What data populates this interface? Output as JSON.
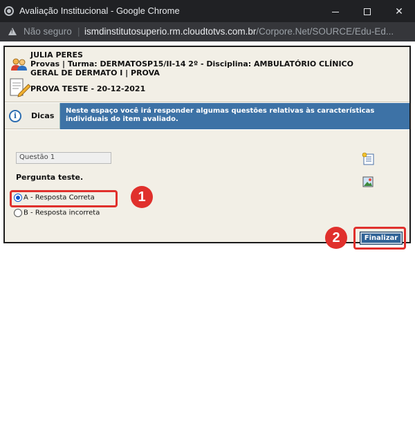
{
  "window": {
    "title": "Avaliação Institucional - Google Chrome",
    "minimize": "—",
    "maximize": "☐",
    "close": "✕"
  },
  "addressbar": {
    "security": "Não seguro",
    "separator": "|",
    "host": "ismdinstitutosuperio.rm.cloudtotvs.com.br",
    "path": "/Corpore.Net/SOURCE/Edu-Ed..."
  },
  "header": {
    "student_name": "JULIA PERES",
    "info_line1": "Provas | Turma: DERMATOSP15/II-14 2º - Disciplina: AMBULATÓRIO CLÍNICO",
    "info_line2": "GERAL DE DERMATO I | PROVA",
    "prova_title": "PROVA TESTE - 20-12-2021"
  },
  "dicas": {
    "label": "Dicas",
    "text": "Neste espaço você irá responder algumas questões relativas às características individuais do item avaliado."
  },
  "question": {
    "number_label": "Questão 1",
    "prompt": "Pergunta teste.",
    "options": [
      {
        "label": "A - Resposta Correta",
        "checked": true
      },
      {
        "label": "B - Resposta incorreta",
        "checked": false
      }
    ]
  },
  "actions": {
    "finalizar_label": "Finalizar"
  },
  "annotations": {
    "badge1": "1",
    "badge2": "2",
    "color": "#e0302c"
  },
  "icons": [
    "people-icon",
    "document-edit-icon",
    "info-icon",
    "notes-icon",
    "image-icon",
    "warning-icon"
  ]
}
